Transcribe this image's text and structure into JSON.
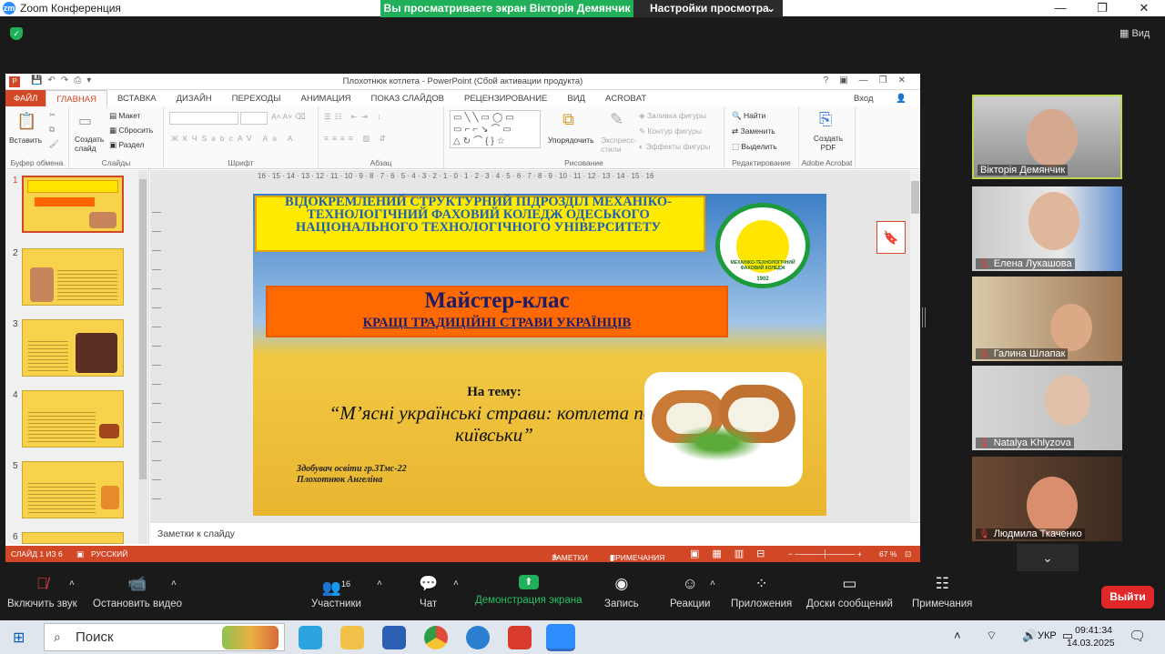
{
  "zoom": {
    "title": "Zoom Конференция",
    "share_banner": "Вы просматриваете экран Вікторія Демянчик",
    "view_settings": "Настройки просмотра",
    "view": "Вид"
  },
  "ppt": {
    "window_title": "Плохотнюк котлета - PowerPoint (Сбой активации продукта)",
    "signin": "Вход",
    "tabs": [
      "ФАЙЛ",
      "ГЛАВНАЯ",
      "ВСТАВКА",
      "ДИЗАЙН",
      "ПЕРЕХОДЫ",
      "АНИМАЦИЯ",
      "ПОКАЗ СЛАЙДОВ",
      "РЕЦЕНЗИРОВАНИЕ",
      "ВИД",
      "ACROBAT"
    ],
    "ribbon": {
      "paste": "Вставить",
      "clipboard": "Буфер обмена",
      "new_slide": "Создать слайд",
      "layout": "Макет",
      "reset": "Сбросить",
      "section": "Раздел",
      "slides": "Слайды",
      "font": "Шрифт",
      "paragraph": "Абзац",
      "arrange": "Упорядочить",
      "quick_styles": "Экспресс-стили",
      "fill": "Заливка фигуры",
      "outline": "Контур фигуры",
      "effects": "Эффекты фигуры",
      "drawing": "Рисование",
      "find": "Найти",
      "replace": "Заменить",
      "select": "Выделить",
      "editing": "Редактирование",
      "create_pdf": "Создать PDF",
      "adobe": "Adobe Acrobat"
    },
    "ruler": "16 · 15 · 14 · 13 · 12 · 11 · 10 · 9 · 8 · 7 · 6 · 5 · 4 · 3 · 2 · 1 · 0 · 1 · 2 · 3 · 4 · 5 · 6 · 7 · 8 · 9 · 10 · 11 · 12 · 13 · 14 · 15 · 16",
    "thumb_numbers": [
      "1",
      "2",
      "3",
      "4",
      "5",
      "6"
    ],
    "slide": {
      "institution": "ВІДОКРЕМЛЕНИЙ СТРУКТУРНИЙ ПІДРОЗДІЛ МЕХАНІКО-ТЕХНОЛОГІЧНИЙ ФАХОВИЙ КОЛЕДЖ ОДЕСЬКОГО НАЦІОНАЛЬНОГО ТЕХНОЛОГІЧНОГО УНІВЕРСИТЕТУ",
      "seal_text": "МЕХАНІКО-ТЕХНОЛОГІЧНИЙ ФАХОВИЙ КОЛЕДЖ",
      "seal_year": "1902",
      "title": "Майстер-клас",
      "subtitle": "КРАЩІ ТРАДИЦІЙНІ СТРАВИ УКРАЇНЦІВ",
      "topic_label": "На тему:",
      "topic": "“М’ясні українські страви: котлета по-київськи”",
      "author_line1": "Здобувач освіти гр.3Тмс-22",
      "author_line2": "Плохотнюк Ангеліна"
    },
    "notes": "Заметки к слайду",
    "status": {
      "slide": "СЛАЙД 1 ИЗ 6",
      "lang": "РУССКИЙ",
      "notes": "ЗАМЕТКИ",
      "comments": "ПРИМЕЧАНИЯ",
      "zoom": "67 %"
    }
  },
  "participants": [
    {
      "name": "Вікторія Демянчик"
    },
    {
      "name": "Елена Лукашова"
    },
    {
      "name": "Галина Шлапак"
    },
    {
      "name": "Natalya Khlyzova"
    },
    {
      "name": "Людмила Ткаченко"
    }
  ],
  "toolbar": {
    "audio": "Включить звук",
    "video": "Остановить видео",
    "participants": "Участники",
    "participants_count": "16",
    "chat": "Чат",
    "share": "Демонстрация экрана",
    "record": "Запись",
    "reactions": "Реакции",
    "apps": "Приложения",
    "whiteboards": "Доски сообщений",
    "notes": "Примечания",
    "leave": "Выйти"
  },
  "taskbar": {
    "search": "Поиск",
    "lang": "УКР",
    "time": "09:41:34",
    "date": "14.03.2025"
  },
  "colors": {
    "share_green": "#20b05a",
    "ppt_red": "#d24726",
    "leave_red": "#e02828"
  }
}
